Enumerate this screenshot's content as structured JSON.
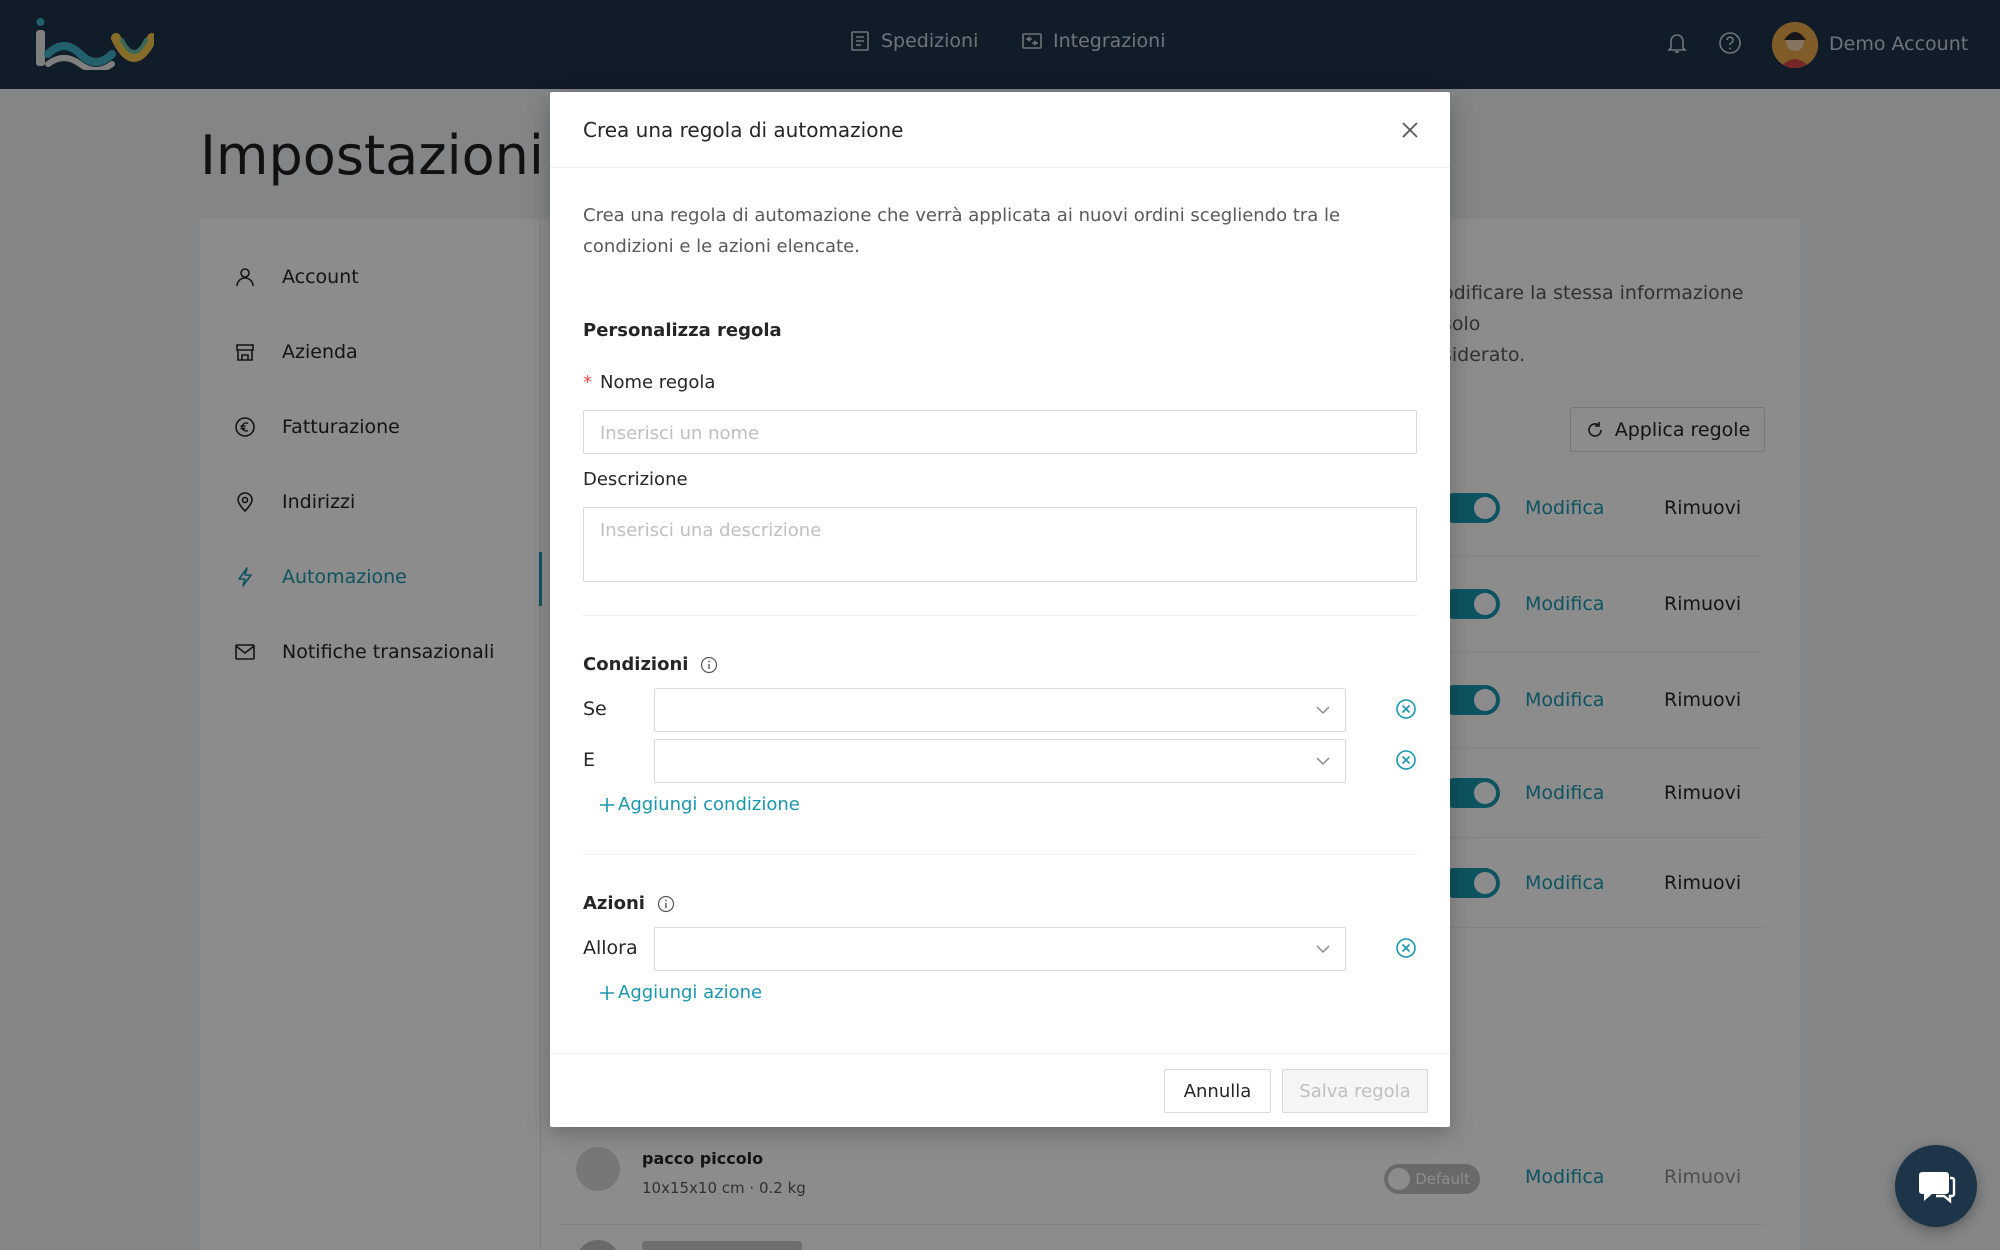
{
  "app": {
    "nav": {
      "shipments": "Spedizioni",
      "integrations": "Integrazioni"
    },
    "account_name": "Demo Account"
  },
  "page": {
    "title": "Impostazioni",
    "sidebar": {
      "items": [
        {
          "label": "Account",
          "icon": "user-icon"
        },
        {
          "label": "Azienda",
          "icon": "store-icon"
        },
        {
          "label": "Fatturazione",
          "icon": "euro-icon"
        },
        {
          "label": "Indirizzi",
          "icon": "location-icon"
        },
        {
          "label": "Automazione",
          "icon": "lightning-icon",
          "active": true
        },
        {
          "label": "Notifiche transazionali",
          "icon": "mail-icon"
        }
      ]
    },
    "background_text_line1": "odificare la stessa informazione solo",
    "background_text_line2": "siderato.",
    "apply_rules_label": "Applica regole",
    "rule_rows": [
      {
        "edit": "Modifica",
        "remove": "Rimuovi"
      },
      {
        "edit": "Modifica",
        "remove": "Rimuovi"
      },
      {
        "edit": "Modifica",
        "remove": "Rimuovi"
      },
      {
        "edit": "Modifica",
        "remove": "Rimuovi"
      },
      {
        "edit": "Modifica",
        "remove": "Rimuovi"
      }
    ],
    "package": {
      "name": "pacco piccolo",
      "dims": "10x15x10 cm · 0.2 kg",
      "toggle_label": "Default",
      "edit": "Modifica",
      "remove": "Rimuovi"
    }
  },
  "modal": {
    "title": "Crea una regola di automazione",
    "intro": "Crea una regola di automazione che verrà applicata ai nuovi ordini scegliendo tra le condizioni e le azioni elencate.",
    "customize_title": "Personalizza regola",
    "name_label": "Nome regola",
    "name_placeholder": "Inserisci un nome",
    "description_label": "Descrizione",
    "description_placeholder": "Inserisci una descrizione",
    "conditions_title": "Condizioni",
    "conditions": [
      {
        "label": "Se",
        "value": ""
      },
      {
        "label": "E",
        "value": ""
      }
    ],
    "add_condition": "Aggiungi condizione",
    "actions_title": "Azioni",
    "actions": [
      {
        "label": "Allora",
        "value": ""
      }
    ],
    "add_action": "Aggiungi azione",
    "cancel_label": "Annulla",
    "save_label": "Salva regola"
  },
  "colors": {
    "topbar": "#1e3448",
    "accent": "#1a97b0",
    "required": "#ff4d4f"
  }
}
